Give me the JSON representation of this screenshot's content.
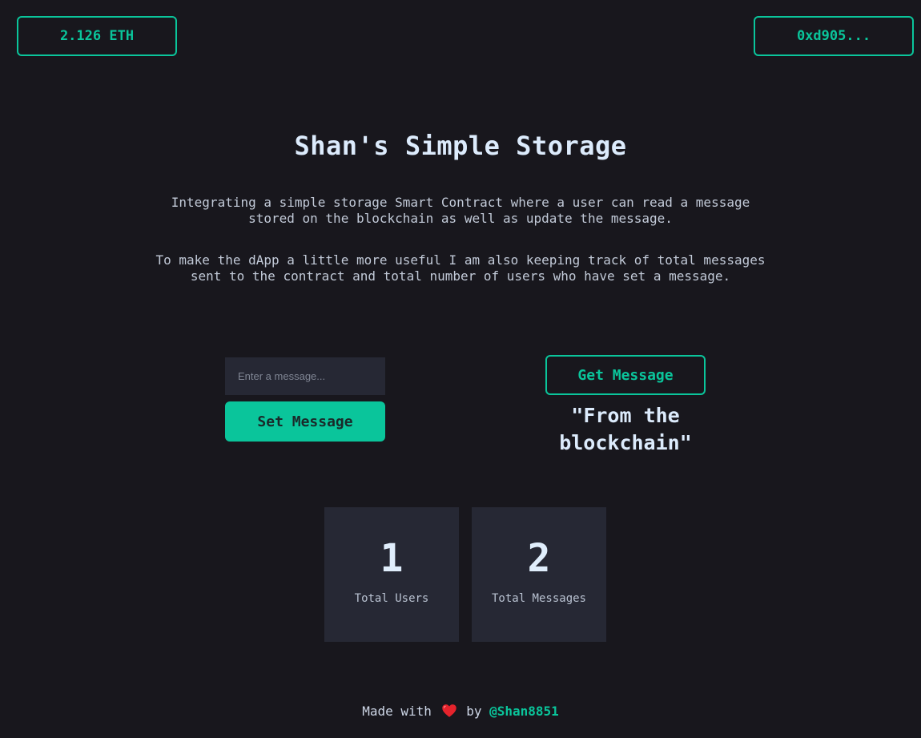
{
  "header": {
    "balance": "2.126 ETH",
    "account": "0xd905..."
  },
  "main": {
    "title": "Shan's Simple Storage",
    "description_1": "Integrating a simple storage Smart Contract where a user can read a message stored on the blockchain as well as update the message.",
    "description_2": "To make the dApp a little more useful I am also keeping track of total messages sent to the contract and total number of users who have set a message."
  },
  "set_message": {
    "placeholder": "Enter a message...",
    "value": "",
    "button_label": "Set Message"
  },
  "get_message": {
    "button_label": "Get Message",
    "stored_message": "\"From the blockchain\""
  },
  "stats": [
    {
      "value": "1",
      "label": "Total Users"
    },
    {
      "value": "2",
      "label": "Total Messages"
    }
  ],
  "footer": {
    "prefix": "Made with",
    "heart_icon": "heart-icon",
    "by": "by",
    "author": "@Shan8851"
  },
  "colors": {
    "accent": "#0ac59b",
    "background": "#18171d",
    "card": "#262834",
    "heading": "#dcebfc"
  }
}
